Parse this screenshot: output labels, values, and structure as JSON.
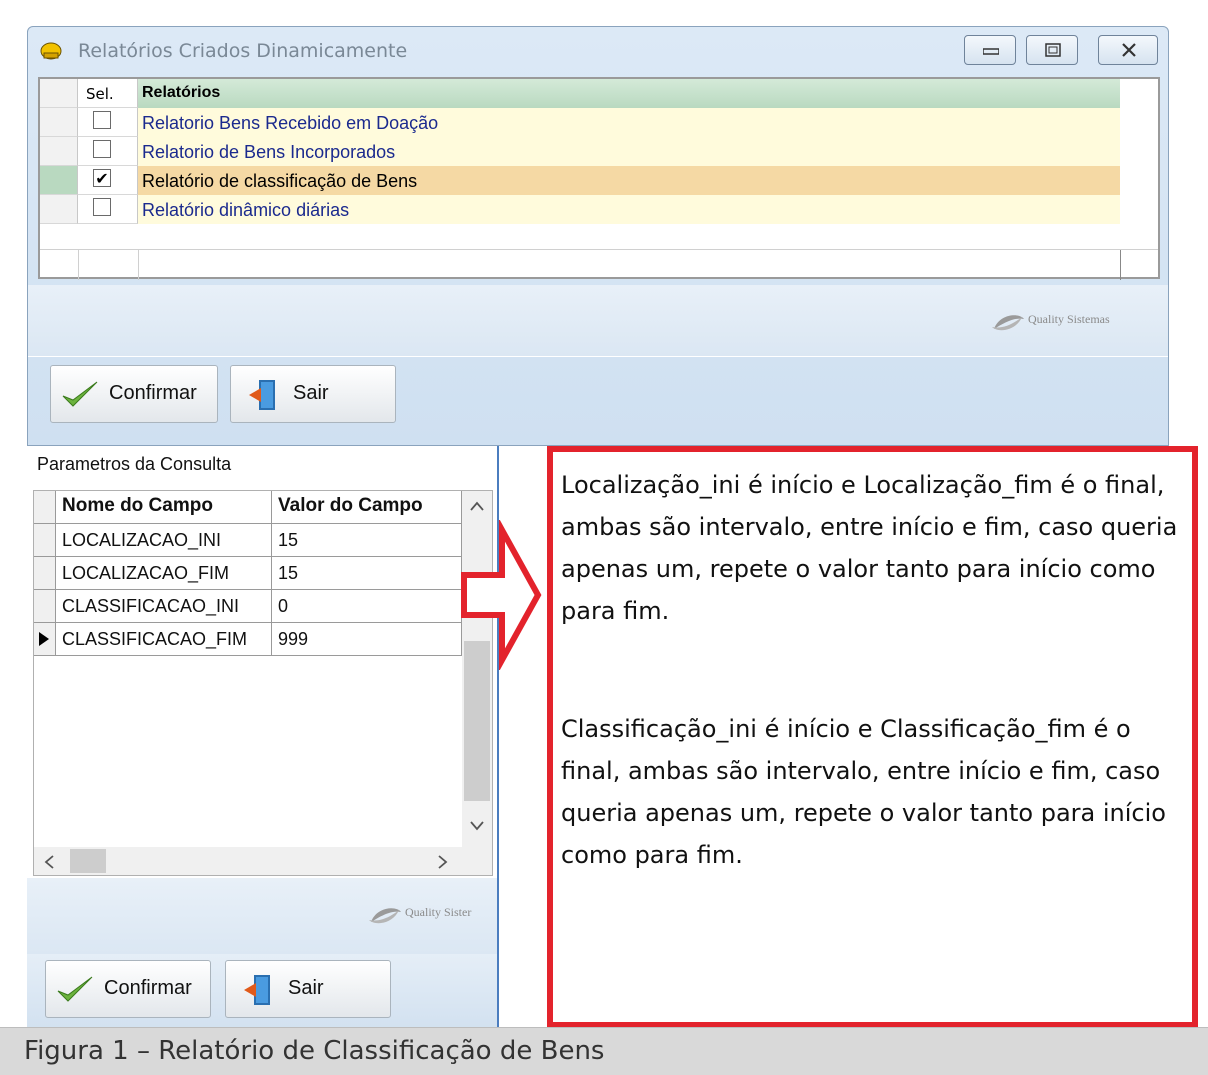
{
  "window": {
    "title": "Relatórios Criados Dinamicamente"
  },
  "reports_grid": {
    "header": {
      "sel": "Sel.",
      "name": "Relatórios"
    },
    "rows": [
      {
        "label": "Relatorio Bens Recebido em Doação",
        "checked": false
      },
      {
        "label": "Relatorio de Bens Incorporados",
        "checked": false
      },
      {
        "label": "Relatório de classificação de Bens",
        "checked": true
      },
      {
        "label": "Relatório dinâmico diárias",
        "checked": false
      }
    ]
  },
  "logo": {
    "name": "Quality Sistemas"
  },
  "buttons": {
    "confirm": "Confirmar",
    "exit": "Sair"
  },
  "params": {
    "title": "Parametros da Consulta",
    "columns": {
      "name": "Nome do Campo",
      "value": "Valor do Campo"
    },
    "rows": [
      {
        "name": "LOCALIZACAO_INI",
        "value": "15"
      },
      {
        "name": "LOCALIZACAO_FIM",
        "value": "15"
      },
      {
        "name": "CLASSIFICACAO_INI",
        "value": "0"
      },
      {
        "name": "CLASSIFICACAO_FIM",
        "value": "999"
      }
    ],
    "logo_partial": "Quality Sister"
  },
  "note": {
    "para1": "Localização_ini é início e Localização_fim é o final, ambas  são  intervalo, entre início e fim, caso queria apenas um, repete o valor tanto para início como para fim.",
    "para2": "Classificação_ini é início e Classificação_fim é o final, ambas  são  intervalo, entre início e fim, caso queria apenas um, repete o valor tanto para início como para fim."
  },
  "caption": "Figura 1 – Relatório de Classificação de Bens",
  "colors": {
    "accent_red": "#e3232c",
    "selected_row": "#f5d9a4",
    "row_bg": "#fffbdc"
  }
}
